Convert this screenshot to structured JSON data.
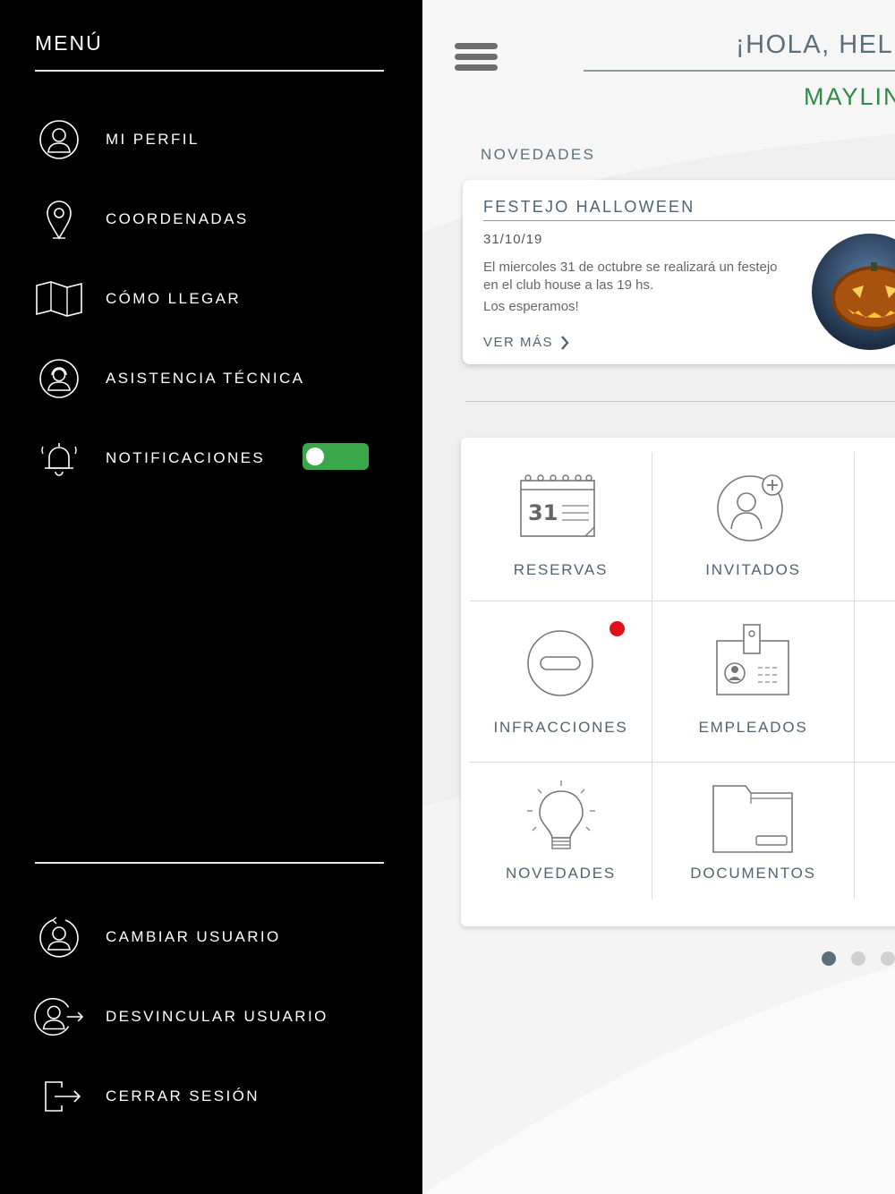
{
  "header": {
    "greeting": "¡HOLA, HELI",
    "user_name": "MAYLIN"
  },
  "news": {
    "section_label": "NOVEDADES",
    "card": {
      "title": "FESTEJO HALLOWEEN",
      "date": "31/10/19",
      "body": "El miercoles 31 de octubre se realizará un festejo en el club house a las 19 hs.",
      "body2": "Los esperamos!",
      "link": "VER MÁS"
    }
  },
  "grid": {
    "tiles": [
      {
        "label": "RESERVAS",
        "icon": "calendar-icon",
        "day": "31"
      },
      {
        "label": "INVITADOS",
        "icon": "add-user-icon"
      },
      {
        "label": "INFRACCIONES",
        "icon": "no-entry-icon",
        "badge": true
      },
      {
        "label": "EMPLEADOS",
        "icon": "id-badge-icon"
      },
      {
        "label": "NOVEDADES",
        "icon": "lightbulb-icon"
      },
      {
        "label": "DOCUMENTOS",
        "icon": "folder-icon"
      }
    ]
  },
  "pager": {
    "pages": 3,
    "active": 1
  },
  "sidebar": {
    "title": "MENÚ",
    "items": [
      {
        "label": "MI PERFIL",
        "icon": "user-icon"
      },
      {
        "label": "COORDENADAS",
        "icon": "location-pin-icon"
      },
      {
        "label": "CÓMO LLEGAR",
        "icon": "map-icon"
      },
      {
        "label": "ASISTENCIA TÉCNICA",
        "icon": "support-icon"
      },
      {
        "label": "NOTIFICACIONES",
        "icon": "bell-icon",
        "toggle": true
      }
    ],
    "bottom_items": [
      {
        "label": "CAMBIAR USUARIO",
        "icon": "switch-user-icon"
      },
      {
        "label": "DESVINCULAR USUARIO",
        "icon": "unlink-user-icon"
      },
      {
        "label": "CERRAR SESIÓN",
        "icon": "logout-icon"
      }
    ]
  },
  "colors": {
    "accent_green": "#3aa84a",
    "name_green": "#2e8a47",
    "slate": "#4f6472",
    "badge_red": "#e0101b"
  }
}
